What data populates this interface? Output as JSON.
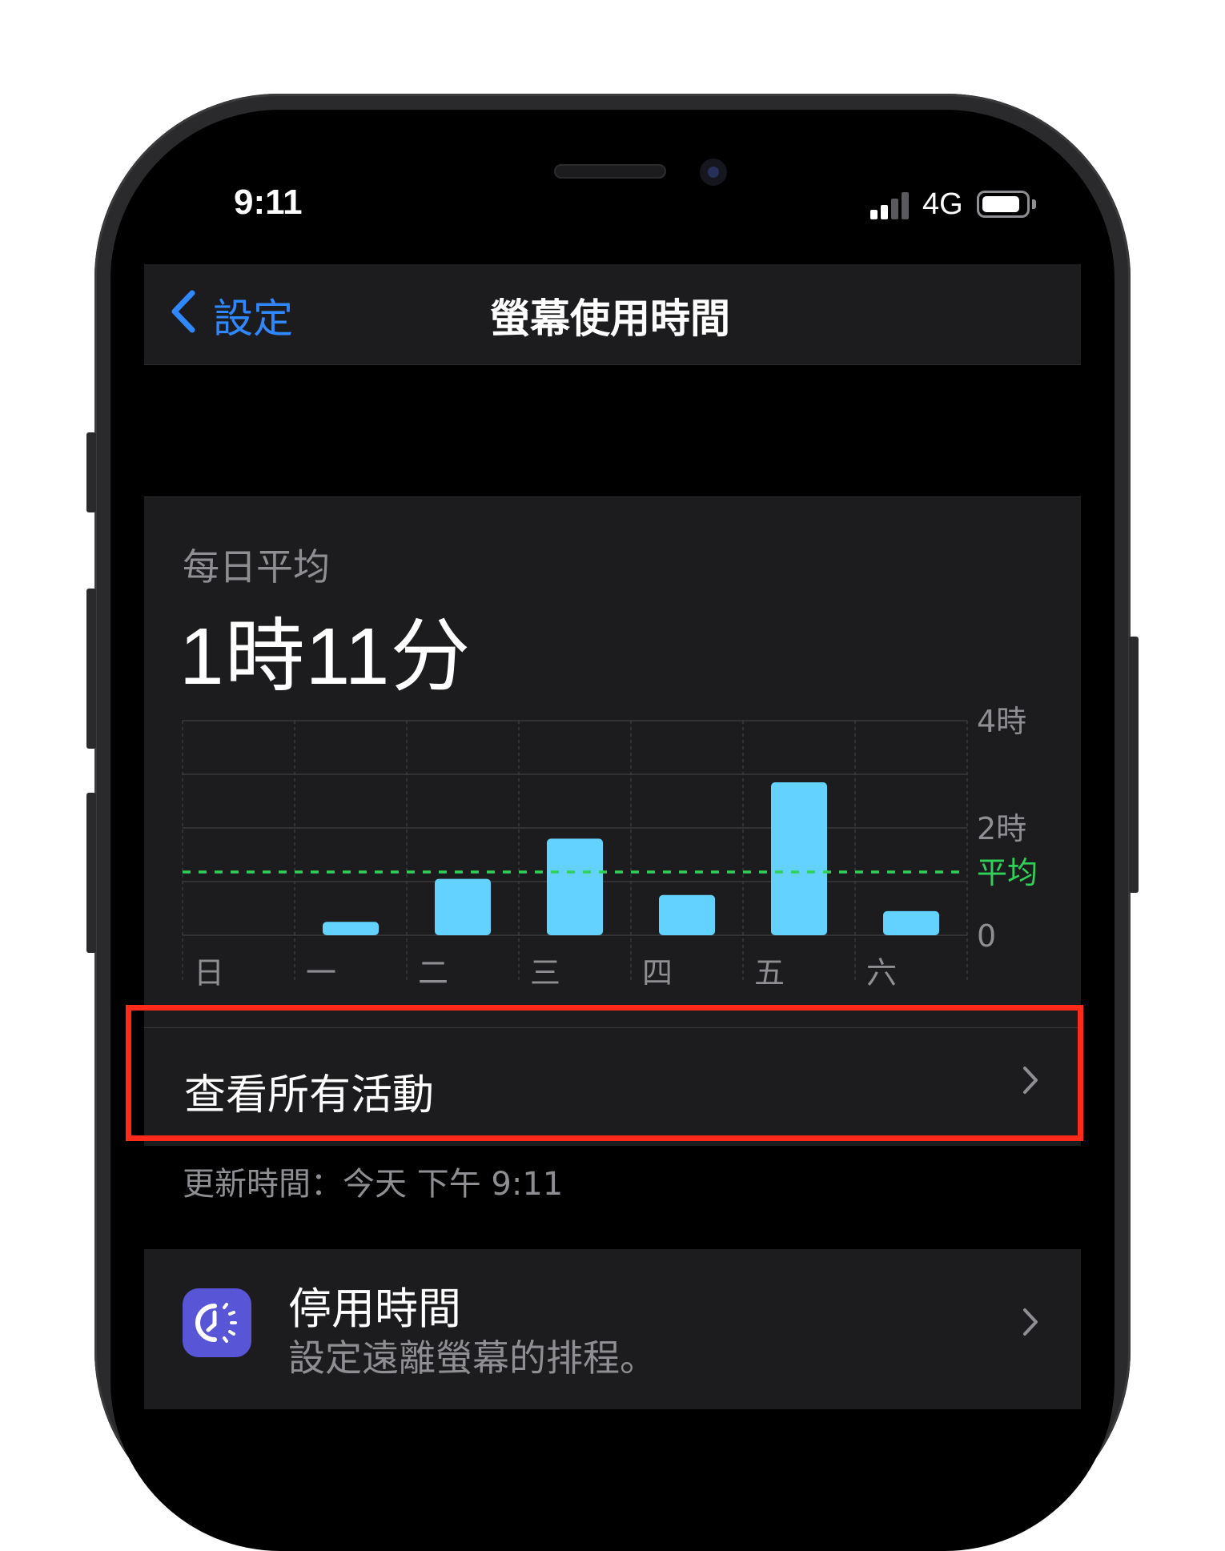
{
  "status_bar": {
    "time": "9:11",
    "network": "4G",
    "icons": [
      "cellular-signal-icon",
      "battery-icon"
    ]
  },
  "nav": {
    "back_label": "設定",
    "title": "螢幕使用時間",
    "back_icon": "chevron-left-icon",
    "accent_color": "#2f88ff"
  },
  "summary": {
    "label": "每日平均",
    "value": "1時11分"
  },
  "chart_data": {
    "type": "bar",
    "categories": [
      "日",
      "一",
      "二",
      "三",
      "四",
      "五",
      "六"
    ],
    "values": [
      0,
      0.25,
      1.05,
      1.8,
      0.75,
      2.85,
      0.45
    ],
    "ylim": [
      0,
      4
    ],
    "y_ticks": [
      "4時",
      "2時",
      "0"
    ],
    "average": 1.18,
    "average_label": "平均",
    "bar_color": "#64d2ff",
    "average_color": "#30d158",
    "grid": true
  },
  "activity": {
    "label": "查看所有活動",
    "chevron_icon": "chevron-right-icon",
    "highlight_color": "#ff2a1a"
  },
  "updated": {
    "text": "更新時間：今天 下午 9:11"
  },
  "downtime": {
    "title": "停用時間",
    "subtitle": "設定遠離螢幕的排程。",
    "icon": "downtime-moon-clock-icon",
    "icon_color": "#5856d6",
    "chevron_icon": "chevron-right-icon"
  }
}
